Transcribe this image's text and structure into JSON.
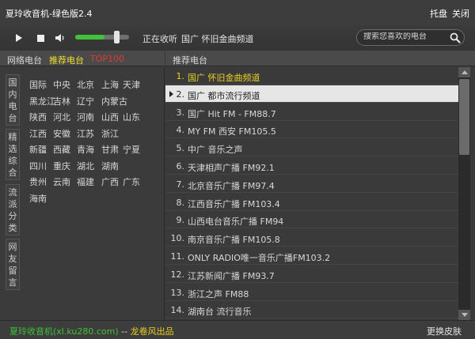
{
  "window": {
    "title": "夏玲收音机-绿色版2.4",
    "tray_label": "托盘",
    "close_label": "关闭"
  },
  "player": {
    "status": "正在收听",
    "current_station": "国广 怀旧金曲频道",
    "volume": 0.78,
    "accent_color": "#41c238"
  },
  "search": {
    "placeholder": "搜索您喜欢的电台"
  },
  "left_tabs": {
    "network": "网络电台",
    "recommended": "推荐电台",
    "top100": "TOP100"
  },
  "vertical_categories": [
    "国内电台",
    "精选综合",
    "流派分类",
    "网友留言"
  ],
  "regions": [
    [
      "国际",
      "中央",
      "北京",
      "上海",
      "天津"
    ],
    [
      "黑龙江",
      "吉林",
      "辽宁",
      "内蒙古"
    ],
    [
      "陕西",
      "河北",
      "河南",
      "山西",
      "山东"
    ],
    [
      "江西",
      "安徽",
      "江苏",
      "浙江"
    ],
    [
      "新疆",
      "西藏",
      "青海",
      "甘肃",
      "宁夏"
    ],
    [
      "四川",
      "重庆",
      "湖北",
      "湖南"
    ],
    [
      "贵州",
      "云南",
      "福建",
      "广西",
      "广东"
    ],
    [
      "海南"
    ]
  ],
  "list": {
    "header": "推荐电台",
    "playing_index": 0,
    "selected_index": 1,
    "items": [
      {
        "num": "1.",
        "name": "国广 怀旧金曲频道"
      },
      {
        "num": "2.",
        "name": "国广 都市流行频道"
      },
      {
        "num": "3.",
        "name": "国广 Hit FM - FM88.7"
      },
      {
        "num": "4.",
        "name": "MY FM 西安 FM105.5"
      },
      {
        "num": "5.",
        "name": "中广 音乐之声"
      },
      {
        "num": "6.",
        "name": "天津相声广播 FM92.1"
      },
      {
        "num": "7.",
        "name": "北京音乐广播 FM97.4"
      },
      {
        "num": "8.",
        "name": "江西音乐广播 FM103.4"
      },
      {
        "num": "9.",
        "name": "山西电台音乐广播 FM94"
      },
      {
        "num": "10.",
        "name": "南京音乐广播 FM105.8"
      },
      {
        "num": "11.",
        "name": "ONLY RADIO唯一音乐广播FM103.2"
      },
      {
        "num": "12.",
        "name": "江苏新闻广播 FM93.7"
      },
      {
        "num": "13.",
        "name": "浙江之声 FM88"
      },
      {
        "num": "14.",
        "name": "湖南台 流行音乐"
      }
    ]
  },
  "footer": {
    "credit": "夏玲收音机(xl.ku280.com)",
    "separator": "--",
    "maker": "龙卷风出品",
    "skin_button": "更换皮肤"
  }
}
